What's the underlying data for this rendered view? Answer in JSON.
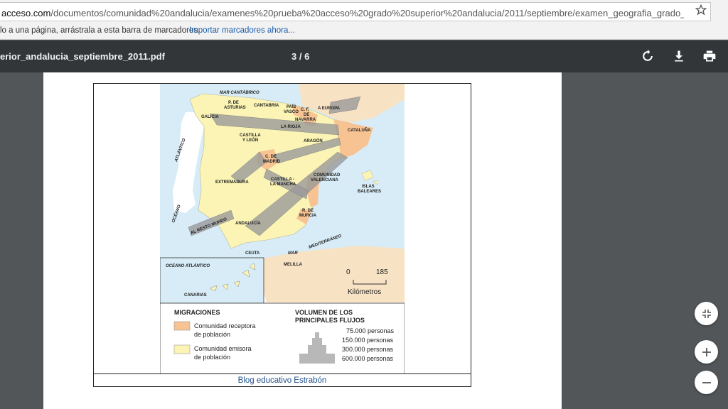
{
  "browser": {
    "url_prefix": "acceso.com",
    "url_rest": "/documentos/comunidad%20andalucia/examenes%20prueba%20acceso%20grado%20superior%20andalucia/2011/septiembre/examen_geografia_grado_sup...",
    "bookmarks_hint": "lo a una página, arrástrala a esta barra de marcadores.",
    "import_link": "Importar marcadores ahora..."
  },
  "pdf_toolbar": {
    "filename": "erior_andalucia_septiembre_2011.pdf",
    "page_indicator": "3  /  6",
    "icons": [
      "rotate-icon",
      "download-icon",
      "print-icon"
    ]
  },
  "map": {
    "seas": {
      "cantabrico": "MAR CANTÁBRICO",
      "atlantico": "OCÉANO ATLÁNTICO",
      "oceano_word": "OCÉANO",
      "atlantico_word": "ATLÁNTICO",
      "mediterraneo_mar": "MAR",
      "mediterraneo": "MEDITERRÁNEO",
      "canarias_ocean": "OCEANO ATLÁNTICO"
    },
    "flows": {
      "europa": "A EUROPA",
      "resto_mundo": "AL RESTO MUNDO"
    },
    "regions": {
      "asturias": [
        "P. DE",
        "ASTURIAS"
      ],
      "cantabria": "CANTABRIA",
      "pais_vasco": [
        "PAÍS",
        "VASCO"
      ],
      "navarra": [
        "C. F.",
        "DE",
        "NAVARRA"
      ],
      "galicia": "GALICIA",
      "rioja": "LA RIOJA",
      "cataluna": "CATALUÑA",
      "castilla_leon": [
        "CASTILLA",
        "Y LEÓN"
      ],
      "aragon": "ARAGÓN",
      "madrid": [
        "C. DE",
        "MADRID"
      ],
      "extremadura": "EXTREMADURA",
      "castilla_mancha": [
        "CASTILLA -",
        "LA MANCHA"
      ],
      "valenciana": [
        "COMUNIDAD",
        "VALENCIANA"
      ],
      "baleares": [
        "ISLAS",
        "BALEARES"
      ],
      "murcia": [
        "R. DE",
        "MURCIA"
      ],
      "andalucia": "ANDALUCÍA",
      "ceuta": "CEUTA",
      "melilla": "MELILLA",
      "canarias": "CANARIAS"
    },
    "scale": {
      "zero": "0",
      "max": "185",
      "unit": "Kilómetros"
    },
    "legend": {
      "migraciones_title": "MIGRACIONES",
      "receptora": [
        "Comunidad receptora",
        "de población"
      ],
      "emisora": [
        "Comunidad emisora",
        "de población"
      ],
      "volumen_title": [
        "VOLUMEN DE LOS",
        "PRINCIPALES FLUJOS"
      ],
      "volumes": [
        "75.000 personas",
        "150.000 personas",
        "300.000 personas",
        "600.000 personas"
      ]
    },
    "colors": {
      "sea": "#d7ecf7",
      "emisora": "#fbf4b4",
      "receptora": "#f7c393",
      "foreign": "#f8e2c4",
      "flow": "#9a9a9a"
    }
  },
  "credit": "Blog educativo Estrabón",
  "zoom_controls": [
    "fit-page-icon",
    "zoom-in-icon",
    "zoom-out-icon"
  ]
}
